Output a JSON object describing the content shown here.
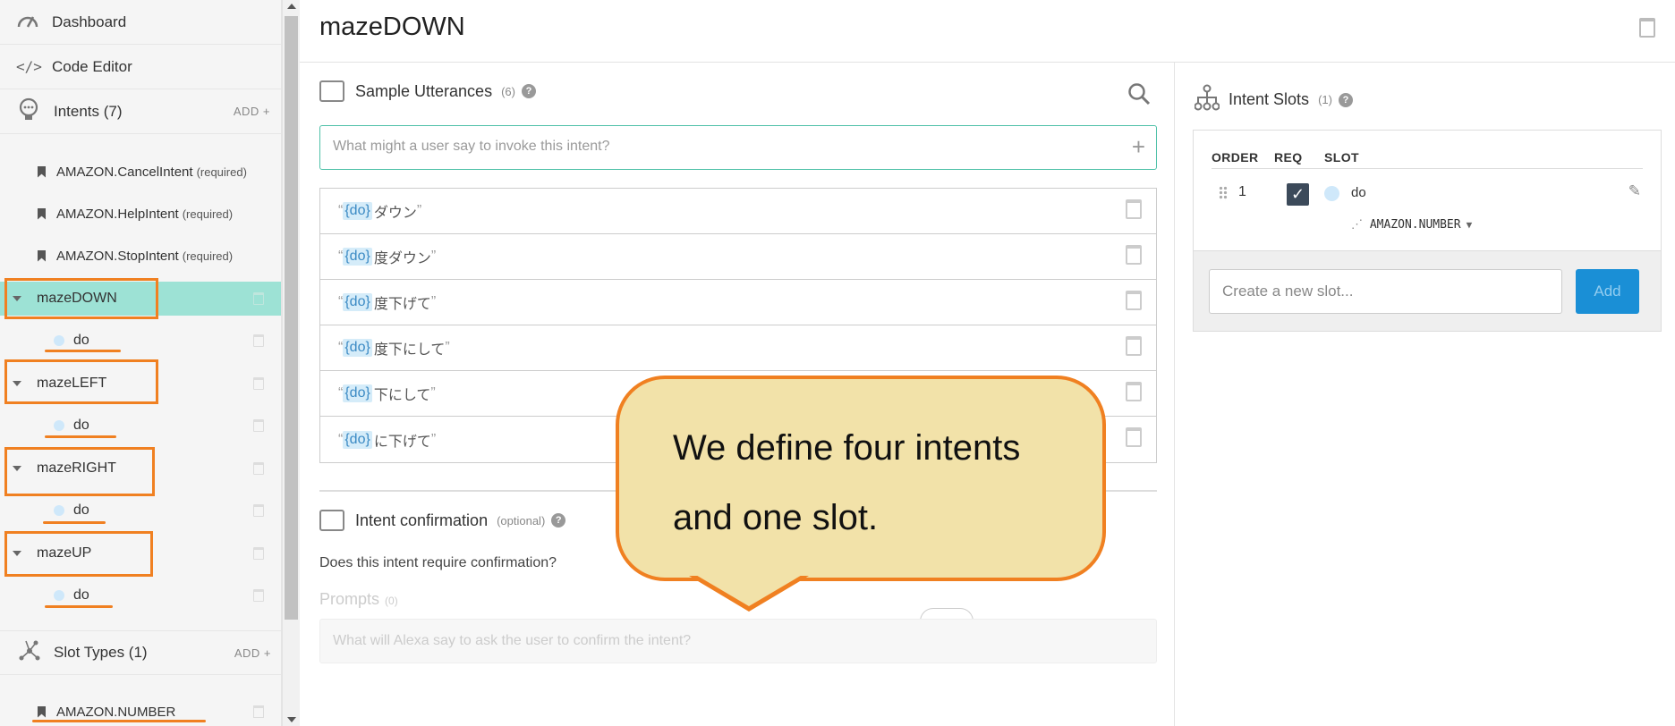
{
  "sidebar": {
    "nav": [
      {
        "label": "Dashboard",
        "icon": "gauge-icon"
      },
      {
        "label": "Code Editor",
        "icon": "code-icon"
      }
    ],
    "intents_header": {
      "label": "Intents (7)",
      "add": "ADD +"
    },
    "builtin_intents": [
      {
        "name": "AMAZON.CancelIntent",
        "note": "(required)"
      },
      {
        "name": "AMAZON.HelpIntent",
        "note": "(required)"
      },
      {
        "name": "AMAZON.StopIntent",
        "note": "(required)"
      }
    ],
    "custom_intents": [
      {
        "name": "mazeDOWN",
        "slot": "do",
        "active": true
      },
      {
        "name": "mazeLEFT",
        "slot": "do",
        "active": false
      },
      {
        "name": "mazeRIGHT",
        "slot": "do",
        "active": false
      },
      {
        "name": "mazeUP",
        "slot": "do",
        "active": false
      }
    ],
    "slot_types_header": {
      "label": "Slot Types (1)",
      "add": "ADD +"
    },
    "slot_types": [
      {
        "name": "AMAZON.NUMBER"
      }
    ]
  },
  "header": {
    "title": "mazeDOWN"
  },
  "utterances": {
    "title": "Sample Utterances",
    "count": "(6)",
    "help": "?",
    "placeholder": "What might a user say to invoke this intent?",
    "plus": "+",
    "items": [
      {
        "open": "“",
        "slot": "{do}",
        "text": "ダウン",
        "close": "”"
      },
      {
        "open": "“",
        "slot": "{do}",
        "text": "度ダウン",
        "close": "”"
      },
      {
        "open": "“",
        "slot": "{do}",
        "text": "度下げて",
        "close": "”"
      },
      {
        "open": "“",
        "slot": "{do}",
        "text": "度下にして",
        "close": "”"
      },
      {
        "open": "“",
        "slot": "{do}",
        "text": "下にして",
        "close": "”"
      },
      {
        "open": "“",
        "slot": "{do}",
        "text": "に下げて",
        "close": "”"
      }
    ]
  },
  "confirmation": {
    "title": "Intent confirmation",
    "optional": "(optional)",
    "help": "?",
    "question": "Does this intent require confirmation?",
    "prompts_label": "Prompts",
    "prompts_count": "(0)",
    "prompt_placeholder": "What will Alexa say to ask the user to confirm the intent?"
  },
  "slots_panel": {
    "title": "Intent Slots",
    "count": "(1)",
    "help": "?",
    "columns": [
      "ORDER",
      "REQ",
      "SLOT"
    ],
    "rows": [
      {
        "order": "1",
        "required": true,
        "check": "✓",
        "name": "do",
        "type": "AMAZON.NUMBER",
        "type_caret": "▼"
      }
    ],
    "new_slot_placeholder": "Create a new slot...",
    "add_label": "Add"
  },
  "callout": {
    "line1": "We define four intents",
    "line2": "and one slot."
  },
  "colors": {
    "accent": "#9de2d5",
    "highlight": "#f08021",
    "callout_fill": "#f2e2a9",
    "primary_button": "#1a8fd6"
  }
}
